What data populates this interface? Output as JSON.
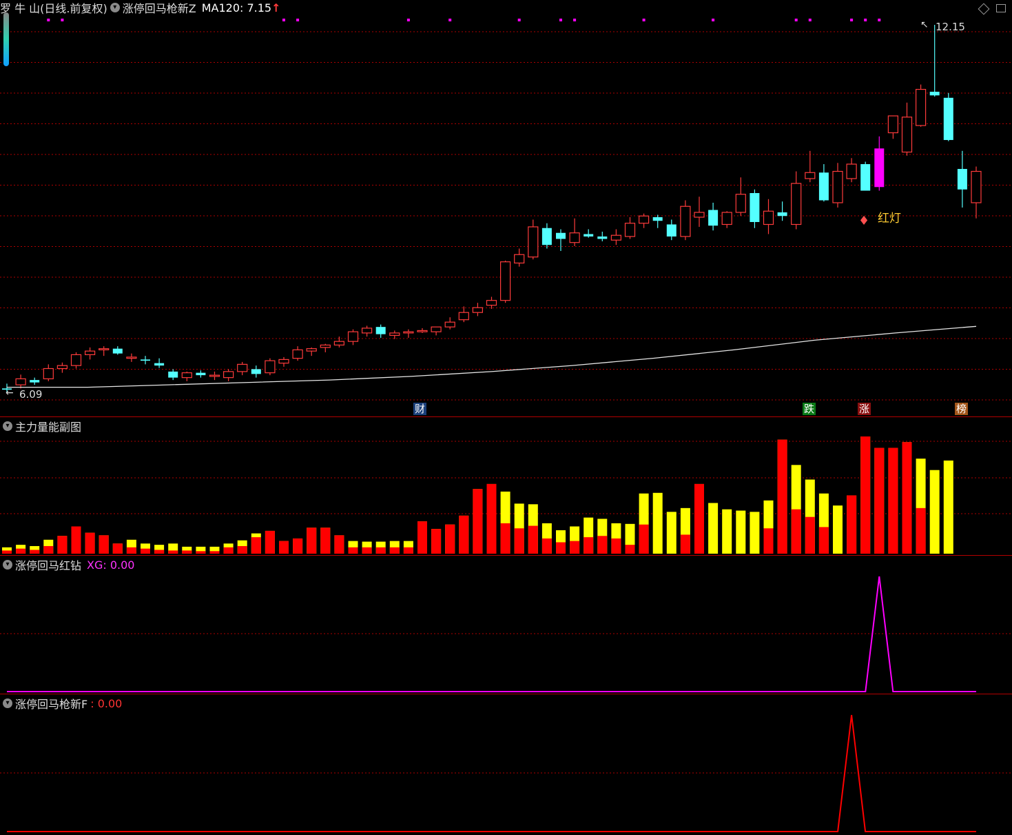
{
  "main_pane": {
    "title": "罗 牛 山(日线.前复权)",
    "indicator": "涨停回马枪新Z",
    "ma_label": "MA120: 7.15",
    "high_label": "12.15",
    "low_label": "6.09",
    "signal_label": "红灯",
    "event_tags": [
      "财",
      "跌",
      "涨",
      "榜"
    ]
  },
  "volume_pane": {
    "title": "主力量能副图"
  },
  "diamond_pane": {
    "title": "涨停回马红钻",
    "value_label": "XG: 0.00"
  },
  "gun_pane": {
    "title": "涨停回马枪新F",
    "value_label": ": 0.00"
  },
  "colors": {
    "up": "#ff3b3b",
    "down": "#54ffff",
    "ma": "#e6e6e6",
    "grid": "#b00000",
    "signal_bar": "#ff00ff",
    "volume_red": "#ff0000",
    "volume_yellow": "#ffff00",
    "diamond_line": "#ff00ff",
    "gun_line": "#ff0000"
  },
  "icons": [
    "chevron-down-icon",
    "diamond-icon",
    "window-icon",
    "red-diamond-icon"
  ],
  "chart_data": [
    {
      "type": "candlestick",
      "title": "罗 牛 山(日线.前复权)",
      "ylim": [
        6.09,
        12.15
      ],
      "ohlc": [
        [
          6.12,
          6.2,
          6.05,
          6.1
        ],
        [
          6.18,
          6.35,
          6.12,
          6.28
        ],
        [
          6.26,
          6.3,
          6.18,
          6.22
        ],
        [
          6.28,
          6.52,
          6.24,
          6.45
        ],
        [
          6.45,
          6.55,
          6.38,
          6.5
        ],
        [
          6.5,
          6.72,
          6.45,
          6.68
        ],
        [
          6.68,
          6.8,
          6.6,
          6.74
        ],
        [
          6.76,
          6.82,
          6.66,
          6.78
        ],
        [
          6.78,
          6.82,
          6.68,
          6.7
        ],
        [
          6.62,
          6.7,
          6.56,
          6.64
        ],
        [
          6.6,
          6.66,
          6.52,
          6.58
        ],
        [
          6.54,
          6.62,
          6.46,
          6.5
        ],
        [
          6.4,
          6.44,
          6.26,
          6.3
        ],
        [
          6.3,
          6.4,
          6.24,
          6.38
        ],
        [
          6.38,
          6.42,
          6.3,
          6.34
        ],
        [
          6.32,
          6.4,
          6.26,
          6.34
        ],
        [
          6.3,
          6.44,
          6.24,
          6.4
        ],
        [
          6.4,
          6.56,
          6.34,
          6.52
        ],
        [
          6.44,
          6.5,
          6.3,
          6.36
        ],
        [
          6.38,
          6.62,
          6.34,
          6.58
        ],
        [
          6.54,
          6.64,
          6.48,
          6.6
        ],
        [
          6.62,
          6.82,
          6.58,
          6.76
        ],
        [
          6.74,
          6.8,
          6.66,
          6.78
        ],
        [
          6.8,
          6.86,
          6.72,
          6.84
        ],
        [
          6.84,
          6.98,
          6.8,
          6.9
        ],
        [
          6.9,
          7.1,
          6.84,
          7.06
        ],
        [
          7.04,
          7.16,
          6.98,
          7.12
        ],
        [
          7.14,
          7.18,
          6.96,
          7.02
        ],
        [
          7.0,
          7.08,
          6.94,
          7.04
        ],
        [
          7.04,
          7.1,
          6.96,
          7.06
        ],
        [
          7.06,
          7.12,
          7.04,
          7.08
        ],
        [
          7.06,
          7.12,
          7.0,
          7.14
        ],
        [
          7.14,
          7.3,
          7.1,
          7.22
        ],
        [
          7.26,
          7.48,
          7.22,
          7.38
        ],
        [
          7.38,
          7.54,
          7.32,
          7.46
        ],
        [
          7.5,
          7.64,
          7.44,
          7.58
        ],
        [
          7.58,
          8.24,
          7.54,
          8.22
        ],
        [
          8.2,
          8.44,
          8.14,
          8.34
        ],
        [
          8.3,
          8.92,
          8.26,
          8.8
        ],
        [
          8.78,
          8.86,
          8.44,
          8.5
        ],
        [
          8.7,
          8.76,
          8.4,
          8.6
        ],
        [
          8.54,
          8.94,
          8.48,
          8.7
        ],
        [
          8.68,
          8.76,
          8.62,
          8.64
        ],
        [
          8.64,
          8.72,
          8.56,
          8.6
        ],
        [
          8.58,
          8.76,
          8.5,
          8.66
        ],
        [
          8.64,
          8.96,
          8.6,
          8.86
        ],
        [
          8.86,
          9.02,
          8.78,
          8.98
        ],
        [
          8.96,
          9.0,
          8.78,
          8.9
        ],
        [
          8.84,
          8.92,
          8.58,
          8.64
        ],
        [
          8.64,
          9.24,
          8.58,
          9.14
        ],
        [
          8.96,
          9.3,
          8.8,
          9.04
        ],
        [
          9.08,
          9.2,
          8.74,
          8.82
        ],
        [
          8.84,
          9.06,
          8.78,
          9.04
        ],
        [
          9.04,
          9.62,
          8.98,
          9.34
        ],
        [
          9.36,
          9.42,
          8.78,
          8.88
        ],
        [
          8.84,
          9.26,
          8.68,
          9.06
        ],
        [
          9.04,
          9.22,
          8.9,
          8.98
        ],
        [
          8.84,
          9.72,
          8.76,
          9.52
        ],
        [
          9.6,
          10.06,
          9.54,
          9.7
        ],
        [
          9.7,
          9.84,
          9.22,
          9.24
        ],
        [
          9.2,
          9.86,
          9.12,
          9.72
        ],
        [
          9.6,
          9.94,
          9.54,
          9.84
        ],
        [
          9.84,
          9.88,
          9.4,
          9.4
        ],
        [
          9.46,
          10.3,
          9.4,
          10.1
        ],
        [
          10.36,
          10.62,
          10.26,
          10.64
        ],
        [
          10.04,
          10.86,
          9.98,
          10.62
        ],
        [
          10.48,
          11.16,
          10.46,
          11.08
        ],
        [
          11.04,
          12.15,
          10.96,
          10.98
        ],
        [
          10.94,
          11.02,
          10.22,
          10.24
        ],
        [
          9.76,
          10.06,
          9.12,
          9.42
        ],
        [
          9.2,
          9.8,
          8.94,
          9.72
        ]
      ],
      "signal_bar_index": 63,
      "ma120": [
        6.14,
        6.14,
        6.18,
        6.22,
        6.26,
        6.32,
        6.4,
        6.5,
        6.62,
        6.76,
        6.92,
        7.04,
        7.15
      ]
    },
    {
      "type": "bar",
      "title": "主力量能副图",
      "series": [
        {
          "values": [
            1.0,
            1.4,
            1.2,
            2.2,
            2.8,
            4.3,
            3.3,
            2.9,
            1.6,
            2.2,
            1.6,
            1.4,
            1.6,
            1.1,
            1.1,
            1.1,
            1.6,
            2.1,
            3.2,
            3.6,
            2.0,
            2.4,
            4.1,
            4.1,
            2.9,
            2.0,
            1.9,
            1.9,
            2.0,
            2.0,
            5.1,
            3.9,
            4.6,
            6.0,
            10.2,
            11.0,
            9.8,
            7.9,
            7.8,
            4.8,
            3.7,
            4.3,
            5.7,
            5.5,
            4.8,
            4.7,
            9.5,
            9.6,
            6.6,
            7.2,
            11.0,
            8.0,
            7.0,
            6.8,
            6.6,
            8.4,
            18.0,
            14.0,
            11.7,
            9.5,
            7.6,
            9.2,
            18.5,
            16.7,
            16.7,
            17.6,
            15.0,
            13.2,
            14.7
          ]
        },
        {
          "values": [
            0.5,
            0.8,
            0.6,
            1.2,
            2.8,
            4.3,
            3.3,
            2.9,
            1.6,
            1.0,
            0.8,
            0.6,
            0.5,
            0.5,
            0.4,
            0.4,
            1.0,
            1.2,
            2.6,
            3.6,
            2.0,
            2.4,
            4.1,
            4.1,
            2.9,
            1.0,
            1.0,
            1.0,
            1.0,
            1.0,
            5.1,
            3.9,
            4.6,
            6.0,
            10.2,
            11.0,
            4.8,
            4.0,
            4.4,
            2.4,
            1.8,
            2.0,
            2.6,
            2.8,
            2.4,
            1.4,
            4.6,
            0.0,
            0.0,
            3.0,
            11.0,
            0.0,
            0.0,
            0.0,
            0.0,
            4.0,
            18.0,
            7.0,
            5.8,
            4.2,
            0.0,
            9.2,
            18.5,
            16.7,
            16.7,
            17.6,
            7.2,
            0.0,
            0.0
          ]
        }
      ]
    },
    {
      "type": "line",
      "title": "涨停回马红钻",
      "series": [
        {
          "name": "XG",
          "values_peak_index": 63,
          "peak": 1.0
        }
      ]
    },
    {
      "type": "line",
      "title": "涨停回马枪新F",
      "series": [
        {
          "values_peak_index": 61,
          "peak": 1.0
        }
      ]
    }
  ]
}
